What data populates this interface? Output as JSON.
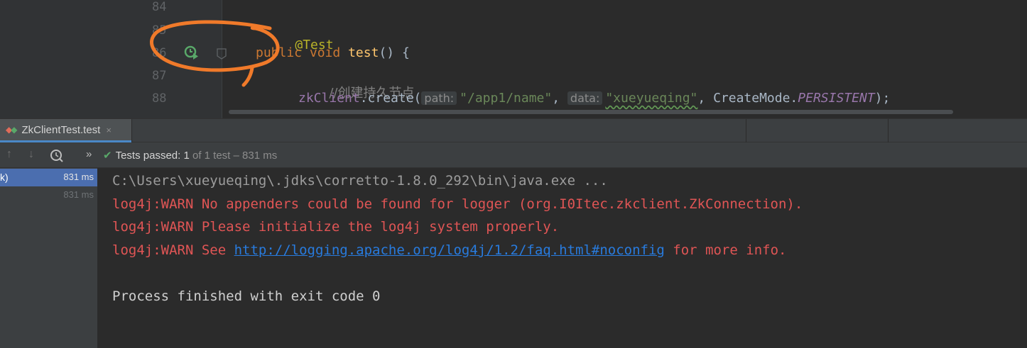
{
  "editor": {
    "line_numbers": [
      "84",
      "85",
      "86",
      "87",
      "88"
    ],
    "lines": {
      "annotation": "@Test",
      "kw_public": "public",
      "kw_void": "void",
      "method_name": "test",
      "method_tail": "() {",
      "comment": "//创建持久节点",
      "receiver": "zkClient",
      "call": ".create(",
      "hint_path": "path:",
      "arg_path": "\"/app1/name\"",
      "sep1": ",",
      "hint_data": "data:",
      "arg_data": "\"xueyueqing\"",
      "sep2": ", CreateMode.",
      "enum_value": "PERSISTENT",
      "tail": ");"
    }
  },
  "run_tab": {
    "label": "ZkClientTest.test",
    "close": "×"
  },
  "toolbar": {
    "expand": "»",
    "status_label": "Tests passed: ",
    "passed_count": "1",
    "status_suffix": " of 1 test – 831 ms"
  },
  "test_tree": [
    {
      "name": "k)",
      "duration": "831 ms"
    },
    {
      "name": "",
      "duration": "831 ms"
    }
  ],
  "console": {
    "line1": "C:\\Users\\xueyueqing\\.jdks\\corretto-1.8.0_292\\bin\\java.exe ...",
    "line2": "log4j:WARN No appenders could be found for logger (org.I0Itec.zkclient.ZkConnection).",
    "line3": "log4j:WARN Please initialize the log4j system properly.",
    "line4_prefix": "log4j:WARN See ",
    "line4_link": "http://logging.apache.org/log4j/1.2/faq.html#noconfig",
    "line4_suffix": " for more info.",
    "line5": "Process finished with exit code 0"
  },
  "colors": {
    "keyword": "#cc7832",
    "annotation": "#bbb529",
    "method": "#ffc66d",
    "string": "#6a8759",
    "warn_text": "#e05555",
    "link": "#287bde",
    "selection": "#4b6eaf",
    "pass_green": "#59a869",
    "circle_marker": "#f07a2a"
  }
}
